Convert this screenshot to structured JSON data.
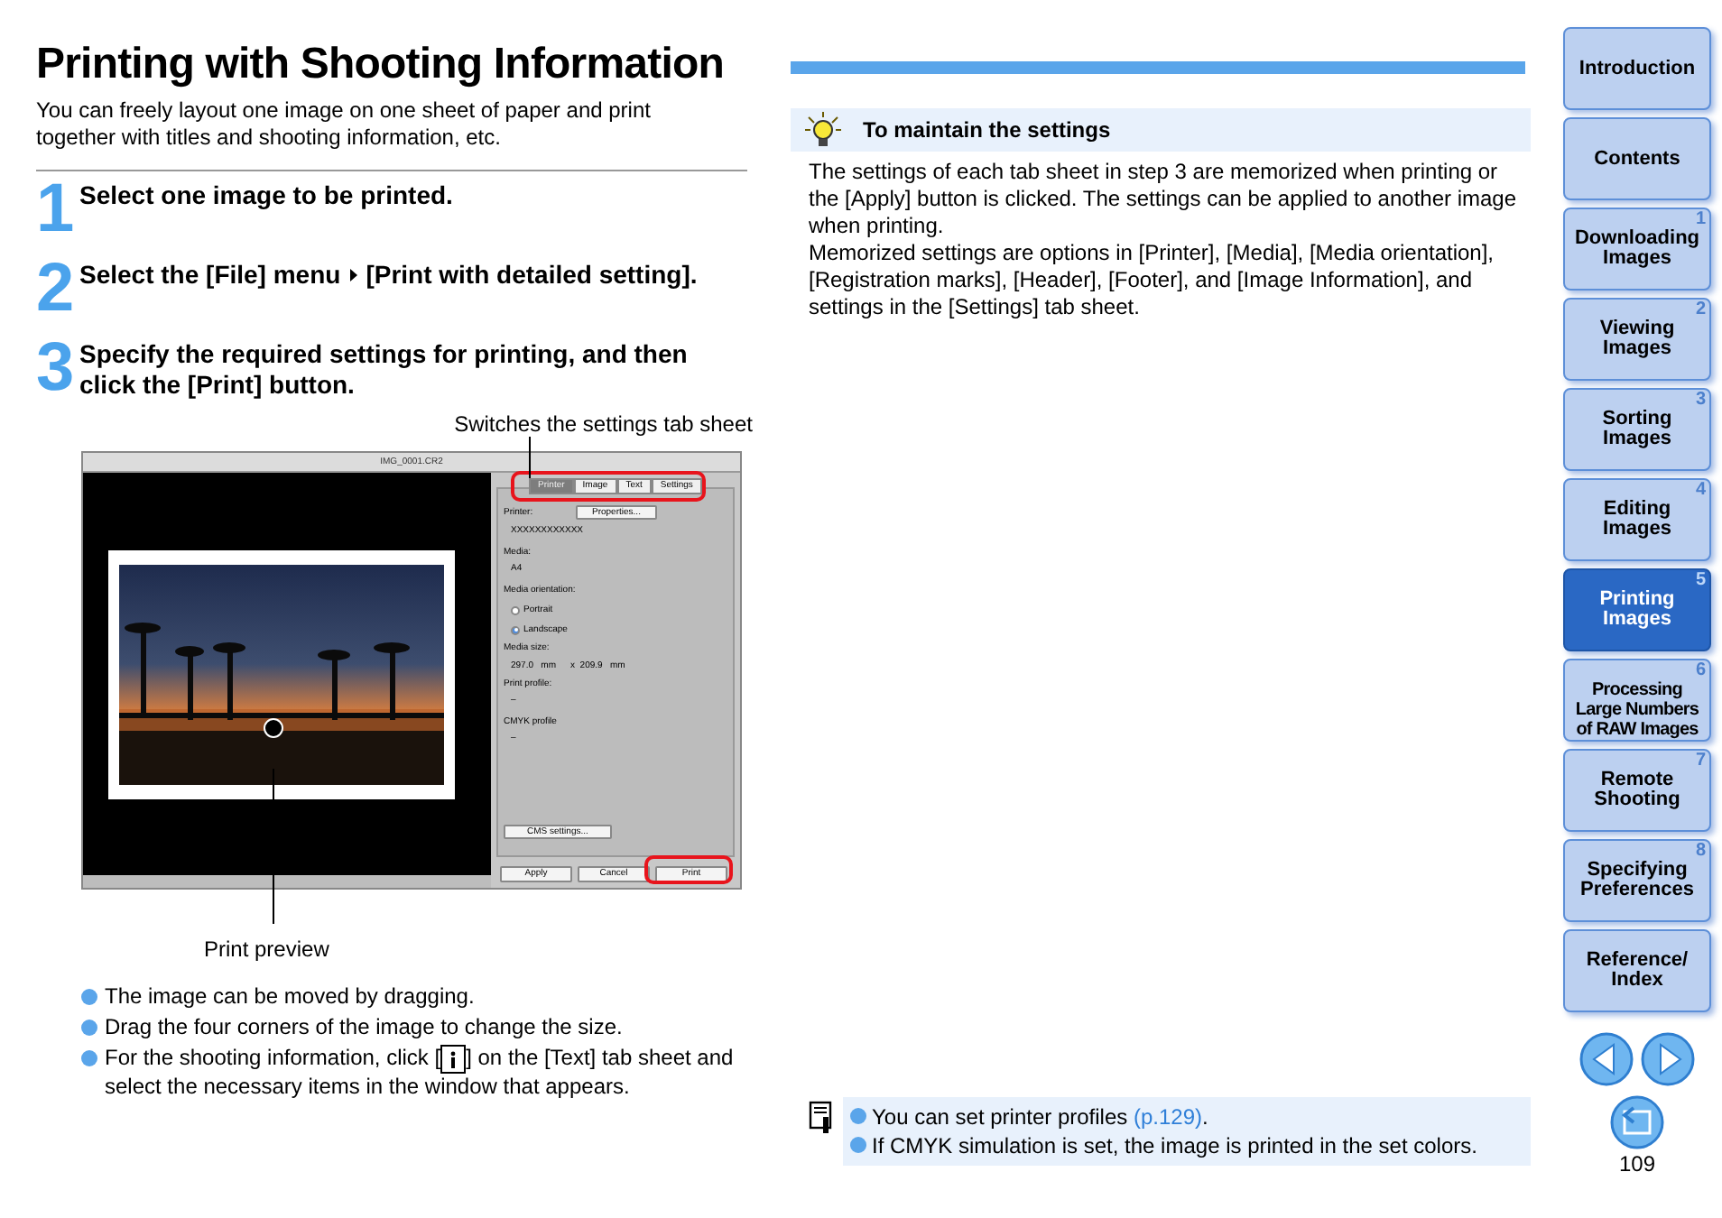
{
  "title": "Printing with Shooting Information",
  "intro": "You can freely layout one image on one sheet of paper and print together with titles and shooting information, etc.",
  "steps": [
    {
      "number": "1",
      "parts": [
        "Select one image to be printed."
      ]
    },
    {
      "number": "2",
      "parts": [
        "Select the [File] menu",
        "[Print with detailed setting]."
      ]
    },
    {
      "number": "3",
      "parts": [
        "Specify the required settings for printing, and then click the [Print] button."
      ]
    }
  ],
  "figure": {
    "tabs_caption": "Switches the settings tab sheet",
    "preview_caption": "Print preview",
    "dialog": {
      "title": "IMG_0001.CR2",
      "tabs_circled": true,
      "tabs": [
        {
          "label": "Printer",
          "selected": true
        },
        {
          "label": "Image",
          "selected": false
        },
        {
          "label": "Text",
          "selected": false
        },
        {
          "label": "Settings",
          "selected": false
        }
      ],
      "rows": [
        {
          "kind": "label_button",
          "label": "Printer:",
          "button": "Properties..."
        },
        {
          "kind": "value",
          "text": "XXXXXXXXXXXX"
        },
        {
          "kind": "label",
          "text": "Media:"
        },
        {
          "kind": "value",
          "text": "A4"
        },
        {
          "kind": "label",
          "text": "Media orientation:"
        },
        {
          "kind": "radio",
          "text": "Portrait",
          "selected": false
        },
        {
          "kind": "radio",
          "text": "Landscape",
          "selected": true
        },
        {
          "kind": "label",
          "text": "Media size:"
        },
        {
          "kind": "size",
          "values": [
            "297.0   mm",
            "x  209.9   mm"
          ]
        },
        {
          "kind": "label",
          "text": "Print profile:"
        },
        {
          "kind": "value",
          "text": "–"
        },
        {
          "kind": "label",
          "text": "CMYK profile"
        },
        {
          "kind": "value",
          "text": "–"
        }
      ],
      "cms_button": "CMS settings...",
      "buttons": [
        {
          "label": "Apply",
          "circled": false
        },
        {
          "label": "Cancel",
          "circled": false
        },
        {
          "label": "Print",
          "circled": true
        }
      ]
    }
  },
  "bullets": [
    {
      "parts": [
        "The image can be moved by dragging."
      ]
    },
    {
      "parts": [
        "Drag the four corners of the image to change the size."
      ]
    },
    {
      "parts": [
        "For the shooting information, click [",
        "] on the [Text] tab sheet and select the necessary items in the window that appears."
      ]
    }
  ],
  "tip": {
    "title": "To maintain the settings",
    "paragraphs": [
      "The settings of each tab sheet in step 3 are memorized when printing or the [Apply] button is clicked. The settings can be applied to another image when printing.",
      "Memorized settings are options in [Printer], [Media], [Media orientation], [Registration marks], [Header], [Footer], and [Image Information], and settings in the [Settings] tab sheet."
    ]
  },
  "notes": [
    {
      "text": "You can set printer profiles ",
      "link": "(p.129)",
      "after": "."
    },
    {
      "text": "If CMYK simulation is set, the image is printed in the set colors."
    }
  ],
  "sidebar": {
    "items": [
      {
        "label": "Introduction",
        "selected": false
      },
      {
        "label": "Contents",
        "selected": false
      },
      {
        "number": "1",
        "label": "Downloading Images",
        "selected": false
      },
      {
        "number": "2",
        "label": "Viewing Images",
        "selected": false
      },
      {
        "number": "3",
        "label": "Sorting Images",
        "selected": false
      },
      {
        "number": "4",
        "label": "Editing Images",
        "selected": false
      },
      {
        "number": "5",
        "label": "Printing Images",
        "selected": true
      },
      {
        "number": "6",
        "label": "Processing Large Numbers of RAW Images",
        "selected": false
      },
      {
        "number": "7",
        "label": "Remote Shooting",
        "selected": false
      },
      {
        "number": "8",
        "label": "Specifying Preferences",
        "selected": false
      },
      {
        "label": "Reference/ Index",
        "selected": false
      }
    ]
  },
  "page_number": "109"
}
